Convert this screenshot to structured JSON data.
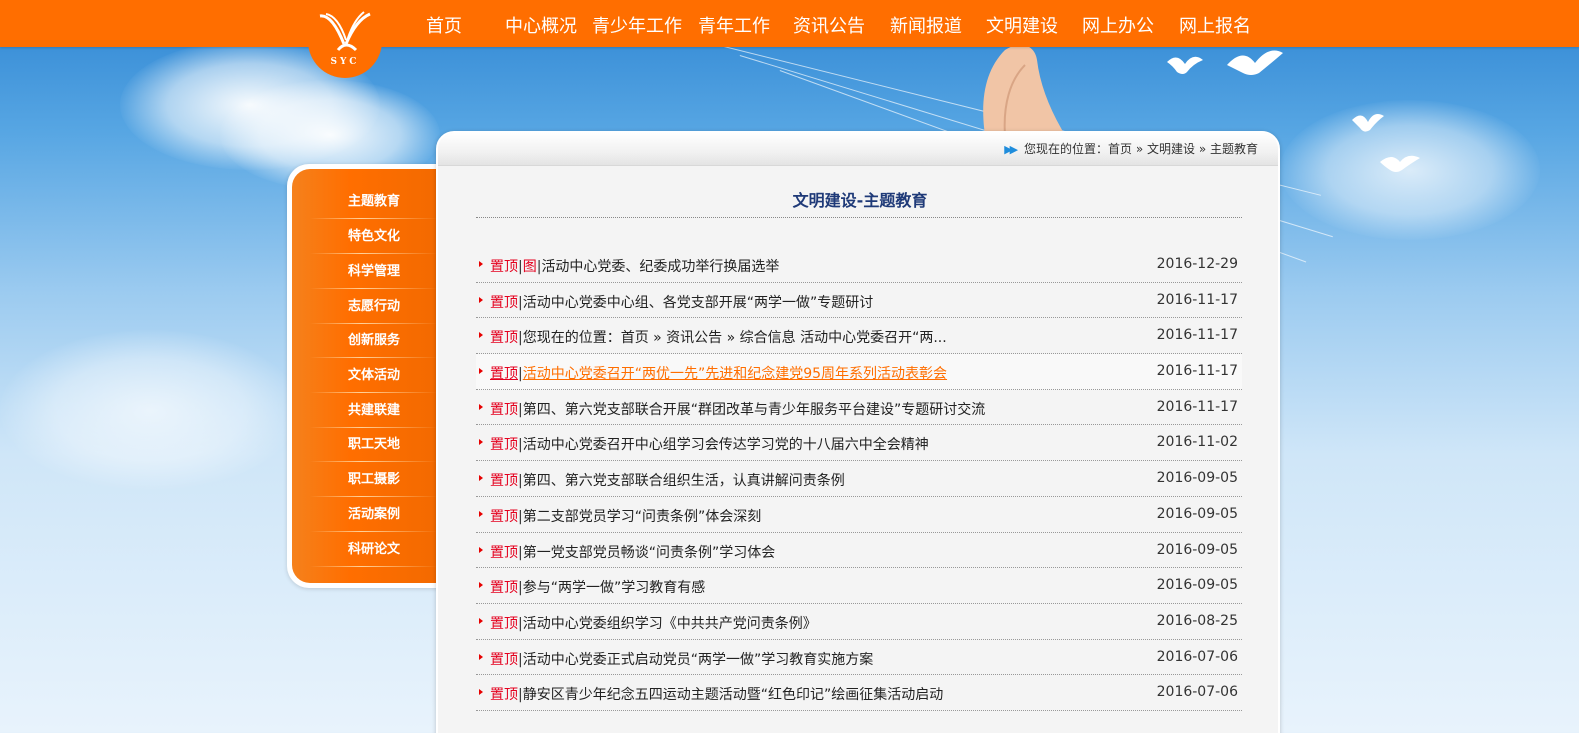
{
  "logo": {
    "text": "SYC"
  },
  "nav": {
    "items": [
      {
        "label": "首页"
      },
      {
        "label": "中心概况"
      },
      {
        "label": "青少年工作"
      },
      {
        "label": "青年工作"
      },
      {
        "label": "资讯公告"
      },
      {
        "label": "新闻报道"
      },
      {
        "label": "文明建设"
      },
      {
        "label": "网上办公"
      },
      {
        "label": "网上报名"
      }
    ]
  },
  "sidebar": {
    "items": [
      {
        "label": "主题教育"
      },
      {
        "label": "特色文化"
      },
      {
        "label": "科学管理"
      },
      {
        "label": "志愿行动"
      },
      {
        "label": "创新服务"
      },
      {
        "label": "文体活动"
      },
      {
        "label": "共建联建"
      },
      {
        "label": "职工天地"
      },
      {
        "label": "职工摄影"
      },
      {
        "label": "活动案例"
      },
      {
        "label": "科研论文"
      }
    ]
  },
  "breadcrumb": {
    "prefix": "您现在的位置：",
    "home": "首页",
    "sep1": " » ",
    "section": "文明建设",
    "sep2": " » ",
    "current": "主题教育"
  },
  "page": {
    "title": "文明建设-主题教育"
  },
  "articles": [
    {
      "tag": "置顶",
      "tag2": "图",
      "title": "活动中心党委、纪委成功举行换届选举",
      "date": "2016-12-29"
    },
    {
      "tag": "置顶",
      "tag2": "",
      "title": "活动中心党委中心组、各党支部开展“两学一做”专题研讨",
      "date": "2016-11-17"
    },
    {
      "tag": "置顶",
      "tag2": "",
      "title": "您现在的位置：首页 » 资讯公告 » 综合信息 活动中心党委召开“两...",
      "date": "2016-11-17"
    },
    {
      "tag": "置顶",
      "tag2": "",
      "title": "活动中心党委召开“两优一先”先进和纪念建党95周年系列活动表彰会",
      "date": "2016-11-17"
    },
    {
      "tag": "置顶",
      "tag2": "",
      "title": "第四、第六党支部联合开展“群团改革与青少年服务平台建设”专题研讨交流",
      "date": "2016-11-17"
    },
    {
      "tag": "置顶",
      "tag2": "",
      "title": "活动中心党委召开中心组学习会传达学习党的十八届六中全会精神",
      "date": "2016-11-02"
    },
    {
      "tag": "置顶",
      "tag2": "",
      "title": "第四、第六党支部联合组织生活，认真讲解问责条例",
      "date": "2016-09-05"
    },
    {
      "tag": "置顶",
      "tag2": "",
      "title": "第二支部党员学习“问责条例”体会深刻",
      "date": "2016-09-05"
    },
    {
      "tag": "置顶",
      "tag2": "",
      "title": "第一党支部党员畅谈“问责条例”学习体会",
      "date": "2016-09-05"
    },
    {
      "tag": "置顶",
      "tag2": "",
      "title": "参与“两学一做”学习教育有感",
      "date": "2016-09-05"
    },
    {
      "tag": "置顶",
      "tag2": "",
      "title": "活动中心党委组织学习《中共共产党问责条例》",
      "date": "2016-08-25"
    },
    {
      "tag": "置顶",
      "tag2": "",
      "title": "活动中心党委正式启动党员“两学一做”学习教育实施方案",
      "date": "2016-07-06"
    },
    {
      "tag": "置顶",
      "tag2": "",
      "title": "静安区青少年纪念五四运动主题活动暨“红色印记”绘画征集活动启动",
      "date": "2016-07-06"
    }
  ],
  "colors": {
    "accent": "#ff6e00",
    "title": "#1f3a78",
    "tag": "#e4001e",
    "breadcrumb_icon": "#1f8ddc"
  },
  "icons": {
    "breadcrumb": "double-chevron-right-icon",
    "row_bullet": "red-triangle-bullet-icon"
  }
}
